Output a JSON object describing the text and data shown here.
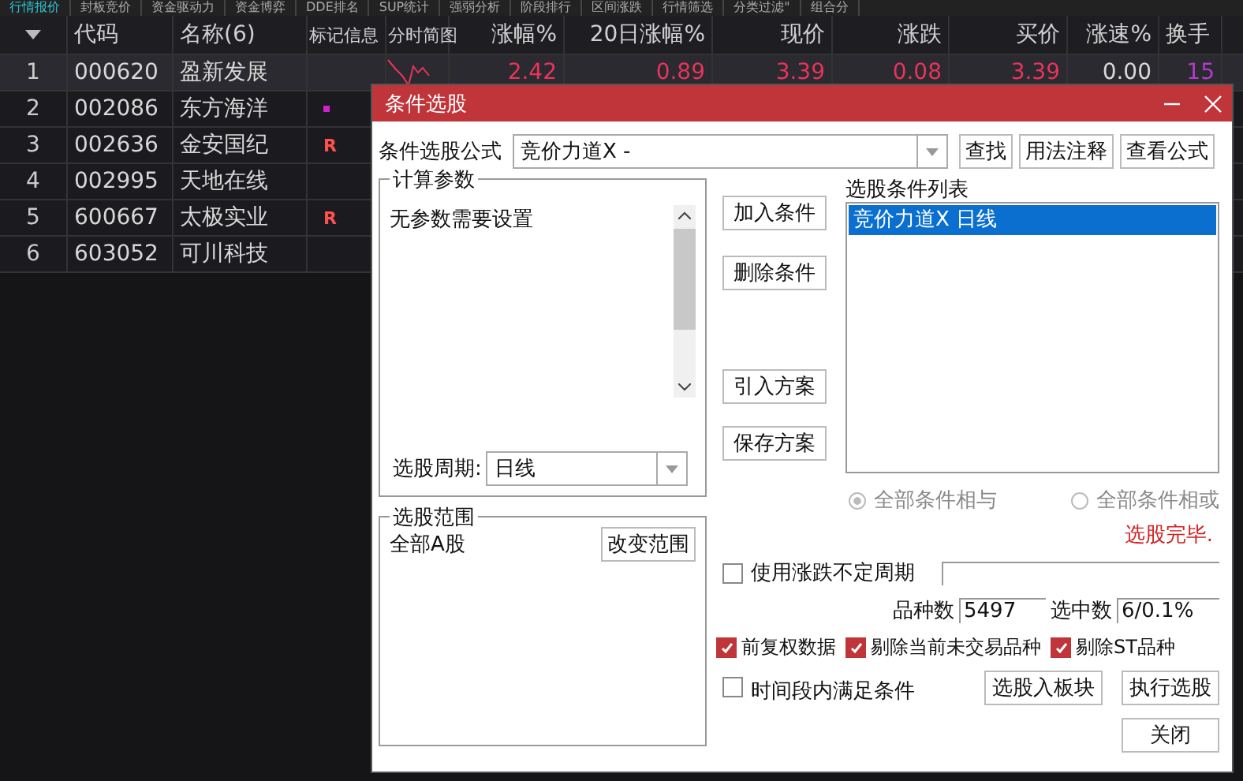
{
  "tabs": [
    {
      "label": "行情报价",
      "selected": true
    },
    {
      "label": "封板竞价",
      "selected": false
    },
    {
      "label": "资金驱动力",
      "selected": false
    },
    {
      "label": "资金博弈",
      "selected": false
    },
    {
      "label": "DDE排名",
      "selected": false
    },
    {
      "label": "SUP统计",
      "selected": false
    },
    {
      "label": "强弱分析",
      "selected": false
    },
    {
      "label": "阶段排行",
      "selected": false
    },
    {
      "label": "区间涨跌",
      "selected": false
    },
    {
      "label": "行情筛选",
      "selected": false
    },
    {
      "label": "分类过滤\"",
      "selected": false
    },
    {
      "label": "组合分",
      "selected": false
    }
  ],
  "table": {
    "columns": [
      "代码",
      "名称(6)",
      "标记信息",
      "分时简图",
      "涨幅%",
      "20日涨幅%",
      "现价",
      "涨跌",
      "买价",
      "涨速%",
      "换手"
    ],
    "rows": [
      {
        "index": "1",
        "code": "000620",
        "name": "盈新发展",
        "selected": true,
        "marker": {
          "kind": "none"
        },
        "values": [
          {
            "text": "2.42",
            "color": "#e8345a"
          },
          {
            "text": "0.89",
            "color": "#e8345a"
          },
          {
            "text": "3.39",
            "color": "#e8345a"
          },
          {
            "text": "0.08",
            "color": "#e8345a"
          },
          {
            "text": "3.39",
            "color": "#e8345a"
          },
          {
            "text": "0.00",
            "color": "#d8d8d8"
          },
          {
            "text": "15",
            "color": "#b03cc8"
          }
        ]
      },
      {
        "index": "2",
        "code": "002086",
        "name": "东方海洋",
        "selected": false,
        "marker": {
          "kind": "dot",
          "color": "#d020d0"
        }
      },
      {
        "index": "3",
        "code": "002636",
        "name": "金安国纪",
        "selected": false,
        "marker": {
          "kind": "letter",
          "text": "R"
        }
      },
      {
        "index": "4",
        "code": "002995",
        "name": "天地在线",
        "selected": false,
        "marker": {
          "kind": "none"
        }
      },
      {
        "index": "5",
        "code": "600667",
        "name": "太极实业",
        "selected": false,
        "marker": {
          "kind": "letter",
          "text": "R"
        }
      },
      {
        "index": "6",
        "code": "603052",
        "name": "可川科技",
        "selected": false,
        "marker": {
          "kind": "none"
        }
      }
    ]
  },
  "dialog": {
    "title": "条件选股",
    "formula": {
      "label": "条件选股公式",
      "value": "竞价力道X  -",
      "buttons": [
        "查找",
        "用法注释",
        "查看公式"
      ]
    },
    "params": {
      "legend": "计算参数",
      "text": "无参数需要设置",
      "period_label": "选股周期:",
      "period_value": "日线"
    },
    "middle_buttons": [
      "加入条件",
      "删除条件",
      "引入方案",
      "保存方案"
    ],
    "conditions": {
      "label": "选股条件列表",
      "items": [
        {
          "text": "竞价力道X  日线",
          "selected": true
        }
      ]
    },
    "logic": [
      {
        "label": "全部条件相与",
        "selected": true
      },
      {
        "label": "全部条件相或",
        "selected": false
      }
    ],
    "status": "选股完毕.",
    "range": {
      "legend": "选股范围",
      "value": "全部A股",
      "button": "改变范围"
    },
    "variable_period": {
      "label": "使用涨跌不定周期",
      "checked": false
    },
    "counts": {
      "variety_label": "品种数",
      "variety": "5497",
      "selected_label": "选中数",
      "selected": "6/0.1%"
    },
    "options": [
      {
        "label": "前复权数据",
        "checked": true
      },
      {
        "label": "剔除当前未交易品种",
        "checked": true
      },
      {
        "label": "剔除ST品种",
        "checked": true
      }
    ],
    "time_window": {
      "label": "时间段内满足条件",
      "checked": false
    },
    "actions": [
      "选股入板块",
      "执行选股",
      "关闭"
    ]
  }
}
